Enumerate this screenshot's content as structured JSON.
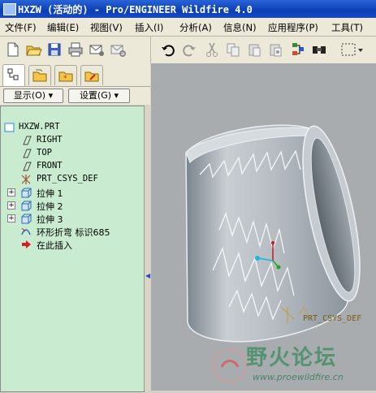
{
  "window": {
    "title": "HXZW (活动的) - Pro/ENGINEER Wildfire 4.0"
  },
  "menu": [
    {
      "label": "文件(F)"
    },
    {
      "label": "编辑(E)"
    },
    {
      "label": "视图(V)"
    },
    {
      "label": "插入(I)"
    },
    {
      "label": "分析(A)"
    },
    {
      "label": "信息(N)"
    },
    {
      "label": "应用程序(P)"
    },
    {
      "label": "工具(T)"
    }
  ],
  "filters": {
    "show_label": "显示(O) ▾",
    "settings_label": "设置(G) ▾"
  },
  "tree": {
    "root": "HXZW.PRT",
    "items": [
      {
        "label": "RIGHT"
      },
      {
        "label": "TOP"
      },
      {
        "label": "FRONT"
      },
      {
        "label": "PRT_CSYS_DEF"
      },
      {
        "label": "拉伸 1"
      },
      {
        "label": "拉伸 2"
      },
      {
        "label": "拉伸 3"
      },
      {
        "label": "环形折弯 标识685"
      },
      {
        "label": "在此插入"
      }
    ]
  },
  "viewport": {
    "csys_label": "PRT_CSYS_DEF",
    "watermark_title": "野火论坛",
    "watermark_url": "www.proewildfire.cn"
  },
  "colors": {
    "tree_bg": "#c9ecd0",
    "viewport_bg": "#a9acae",
    "title_bar": "#0b3fb3"
  }
}
